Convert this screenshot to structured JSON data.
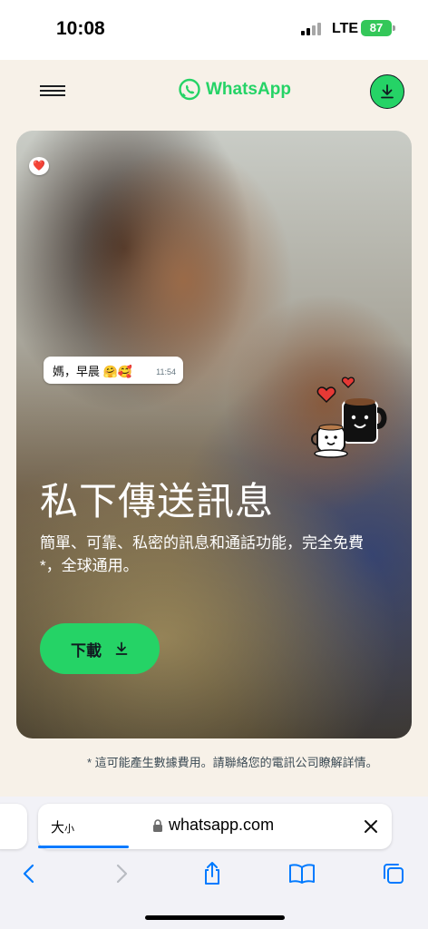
{
  "status_bar": {
    "time": "10:08",
    "network": "LTE",
    "battery": "87"
  },
  "header": {
    "menu_icon": "hamburger-menu-icon",
    "brand_icon": "whatsapp-logo-icon",
    "brand_name": "WhatsApp",
    "download_icon": "download-arrow-icon",
    "brand_color": "#25d366"
  },
  "hero": {
    "chat_bubble": {
      "text": "媽，早晨 🤗🥰",
      "time": "11:54",
      "reaction": "❤️"
    },
    "sticker_icon": "coffee-cups-hearts-sticker",
    "title": "私下傳送訊息",
    "subtitle": "簡單、可靠、私密的訊息和通話功能，完全免費*，全球通用。",
    "cta_label": "下載",
    "cta_icon": "download-arrow-icon"
  },
  "footnote": "* 這可能產生數據費用。請聯絡您的電訊公司瞭解詳情。",
  "browser": {
    "text_size_label_big": "大",
    "text_size_label_small": "小",
    "lock_icon": "lock-icon",
    "url": "whatsapp.com",
    "close_icon": "close-icon",
    "toolbar": [
      "back-icon",
      "forward-icon",
      "share-icon",
      "bookmarks-icon",
      "tabs-icon"
    ],
    "accent": "#007aff"
  }
}
